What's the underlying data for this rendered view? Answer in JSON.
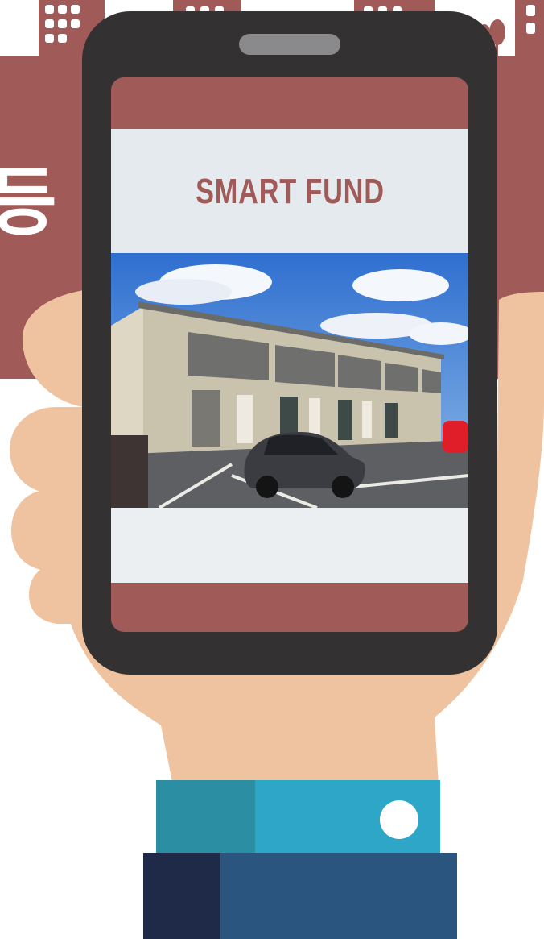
{
  "app": {
    "brand_title": "SMART FUND"
  },
  "background": {
    "side_glyph": "등"
  },
  "icons": {
    "sleeve_button": "circle-button-icon"
  },
  "colors": {
    "brand": "#a05a58",
    "phone_body": "#333132",
    "screen_panel": "#e5eaee",
    "skin": "#efc3a0",
    "cuff_teal": "#2ea6c7",
    "cuff_navy": "#2a557f"
  }
}
